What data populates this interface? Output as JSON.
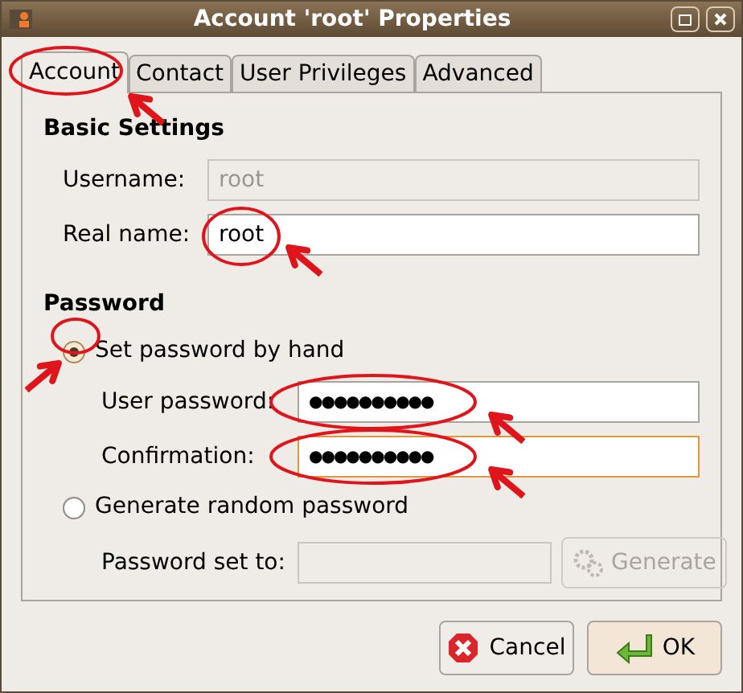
{
  "window": {
    "title": "Account 'root' Properties"
  },
  "tabs": [
    {
      "label": "Account",
      "selected": true
    },
    {
      "label": "Contact",
      "selected": false
    },
    {
      "label": "User Privileges",
      "selected": false
    },
    {
      "label": "Advanced",
      "selected": false
    }
  ],
  "basic_settings": {
    "heading": "Basic Settings",
    "fields": [
      {
        "label": "Username:",
        "value": "root",
        "disabled": true
      },
      {
        "label": "Real name:",
        "value": "root",
        "disabled": false
      }
    ]
  },
  "password": {
    "heading": "Password",
    "options": [
      {
        "label": "Set password by hand",
        "selected": true,
        "fields": [
          {
            "label": "User password:",
            "value": "●●●●●●●●●●",
            "disabled": false,
            "focused": false
          },
          {
            "label": "Confirmation:",
            "value": "●●●●●●●●●●",
            "disabled": false,
            "focused": true
          }
        ]
      },
      {
        "label": "Generate random password",
        "selected": false,
        "fields": [
          {
            "label": "Password set to:",
            "disabled": true,
            "focused": false
          }
        ],
        "button": {
          "label": "Generate",
          "disabled": true
        }
      }
    ]
  },
  "buttons": [
    {
      "label": "Cancel",
      "kind": "cancel"
    },
    {
      "label": "OK",
      "kind": "ok"
    }
  ]
}
